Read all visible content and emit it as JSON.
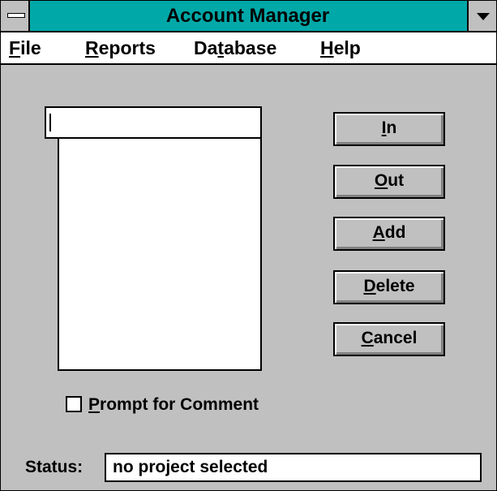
{
  "window": {
    "title": "Account Manager"
  },
  "menu": {
    "file": {
      "first": "F",
      "rest": "ile"
    },
    "reports": {
      "first": "R",
      "rest": "eports"
    },
    "database": {
      "pre": "Da",
      "u": "t",
      "post": "abase"
    },
    "help": {
      "first": "H",
      "rest": "elp"
    }
  },
  "input": {
    "value": ""
  },
  "buttons": {
    "in": {
      "first": "I",
      "rest": "n"
    },
    "out": {
      "first": "O",
      "rest": "ut"
    },
    "add": {
      "first": "A",
      "rest": "dd"
    },
    "delete": {
      "first": "D",
      "rest": "elete"
    },
    "cancel": {
      "first": "C",
      "rest": "ancel"
    }
  },
  "prompt_checkbox": {
    "first": "P",
    "rest": "rompt for Comment",
    "checked": false
  },
  "status": {
    "label": "Status:",
    "value": "no project selected"
  },
  "icons": {
    "system_menu": "minus-bar-icon",
    "dropdown": "triangle-down-icon"
  },
  "colors": {
    "titlebar": "#00a8a8",
    "background": "#c0c0c0",
    "field": "#ffffff"
  }
}
